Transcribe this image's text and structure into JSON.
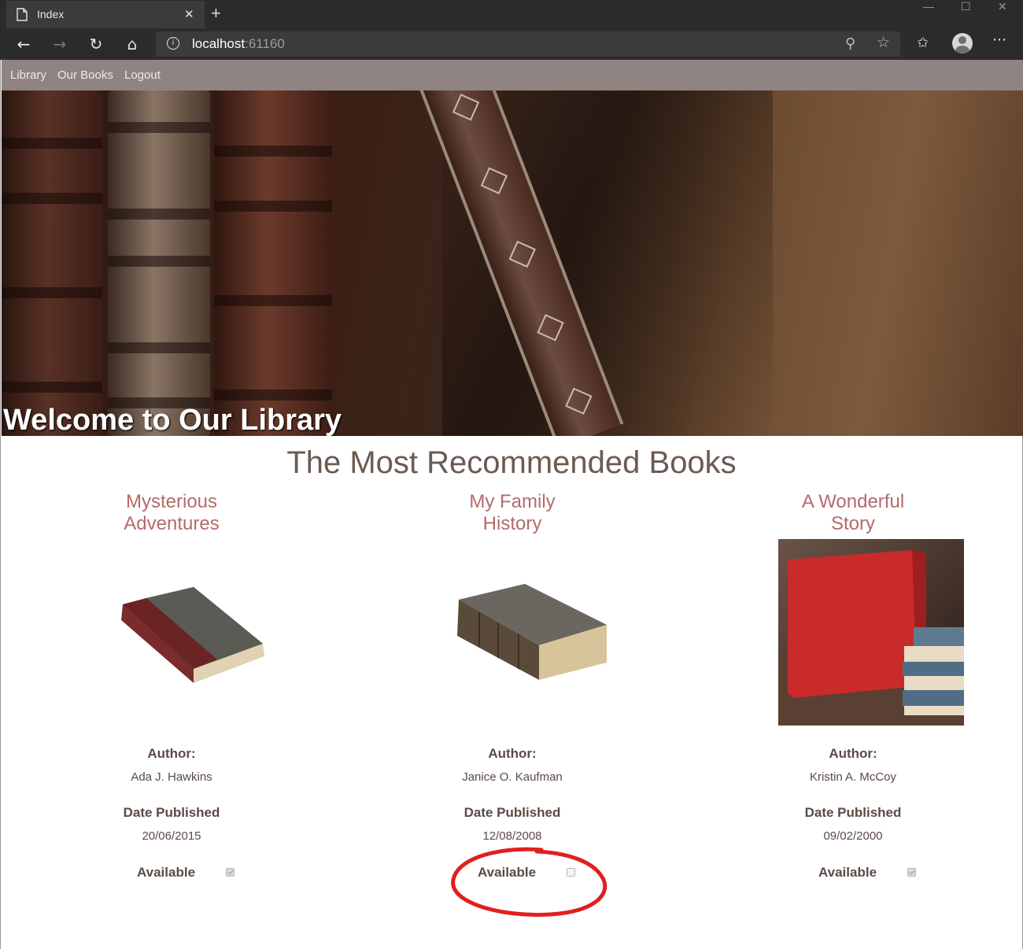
{
  "browser": {
    "tab_title": "Index",
    "url_host": "localhost",
    "url_port": ":61160"
  },
  "nav": {
    "links": [
      "Library",
      "Our Books",
      "Logout"
    ]
  },
  "hero": {
    "title": "Welcome to Our Library"
  },
  "section": {
    "title": "The Most Recommended Books"
  },
  "labels": {
    "author": "Author:",
    "date_published": "Date Published",
    "available": "Available"
  },
  "books": [
    {
      "title_line1": "Mysterious",
      "title_line2": "Adventures",
      "author": "Ada J. Hawkins",
      "date_published": "20/06/2015",
      "available": true
    },
    {
      "title_line1": "My Family",
      "title_line2": "History",
      "author": "Janice O. Kaufman",
      "date_published": "12/08/2008",
      "available": false
    },
    {
      "title_line1": "A Wonderful",
      "title_line2": "Story",
      "author": "Kristin A. McCoy",
      "date_published": "09/02/2000",
      "available": true
    }
  ],
  "colors": {
    "nav_bg": "#8f8482",
    "book_title": "#b56a6a",
    "heading": "#6a5b52",
    "annotation": "#e0201f"
  }
}
